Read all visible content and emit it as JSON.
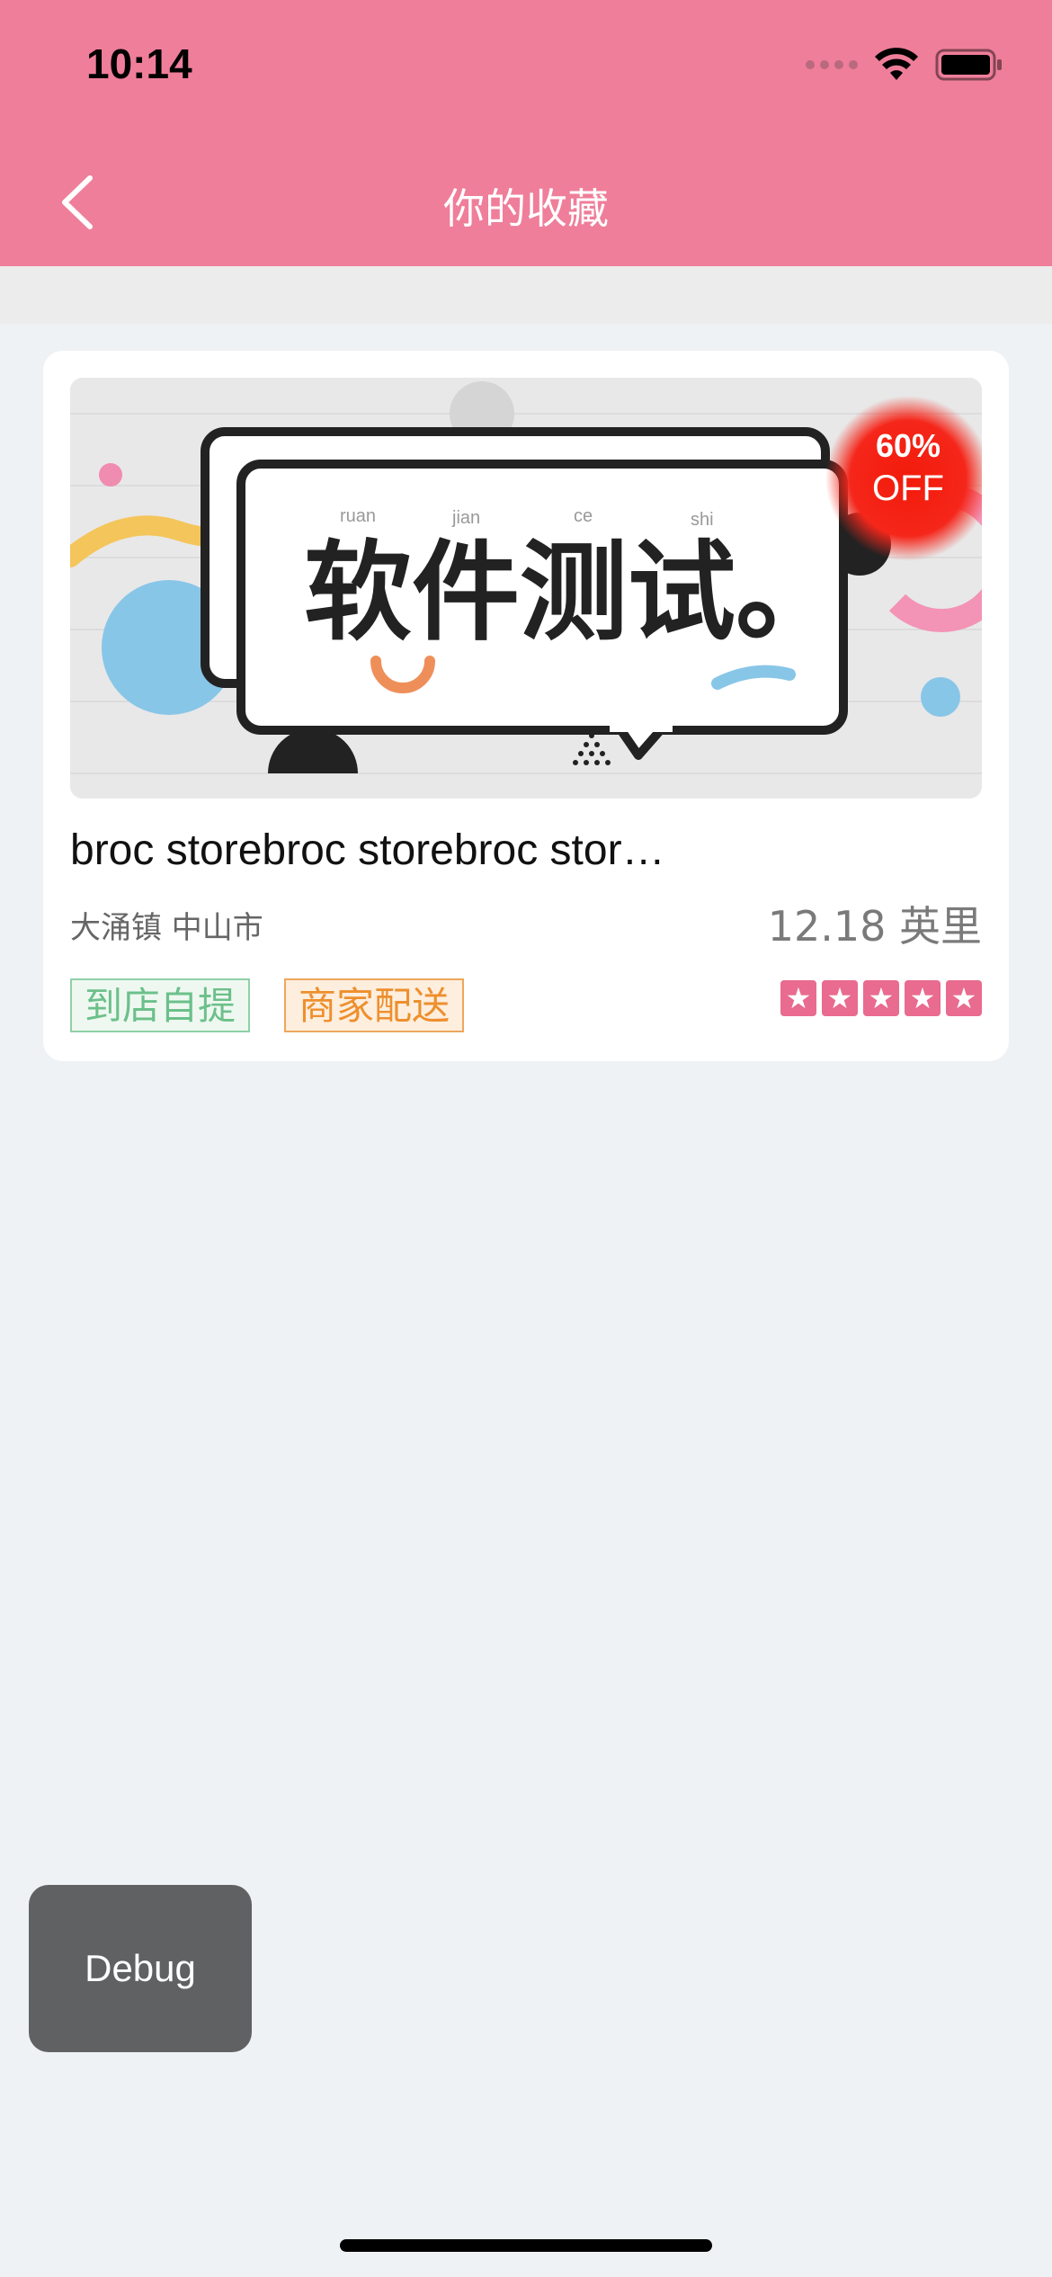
{
  "status": {
    "time": "10:14"
  },
  "nav": {
    "title": "你的收藏",
    "back_icon": "chevron-left-icon"
  },
  "card": {
    "banner": {
      "headline": "软件测试。",
      "pinyin": [
        "ruan",
        "jian",
        "ce",
        "shi"
      ],
      "discount_percent": "60%",
      "discount_off": "OFF"
    },
    "store_name": "broc storebroc storebroc stor…",
    "address": "大涌镇 中山市",
    "distance": "12.18 英里",
    "tags": {
      "pickup": "到店自提",
      "delivery": "商家配送"
    },
    "rating": {
      "stars": 5,
      "max": 5
    }
  },
  "debug": {
    "label": "Debug"
  },
  "colors": {
    "brand": "#ef7e9a",
    "star": "#e96b8f",
    "pickup": "#6cc08a",
    "delivery": "#ee8f2d"
  }
}
